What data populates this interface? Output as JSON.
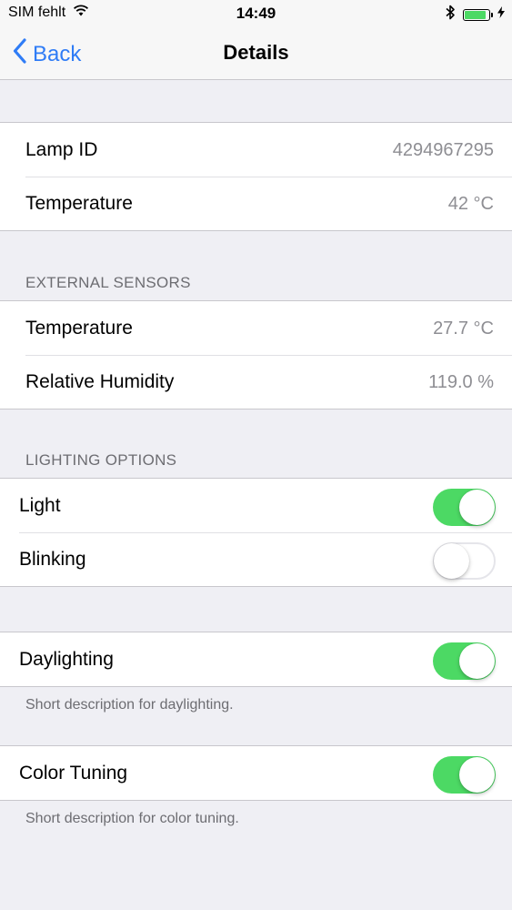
{
  "status_bar": {
    "carrier": "SIM fehlt",
    "time": "14:49",
    "battery_level": 0.9
  },
  "nav": {
    "back_label": "Back",
    "title": "Details"
  },
  "lamp": {
    "rows": [
      {
        "label": "Lamp ID",
        "value": "4294967295"
      },
      {
        "label": "Temperature",
        "value": "42 °C"
      }
    ]
  },
  "external_sensors": {
    "header": "EXTERNAL SENSORS",
    "rows": [
      {
        "label": "Temperature",
        "value": "27.7 °C"
      },
      {
        "label": "Relative Humidity",
        "value": "119.0 %"
      }
    ]
  },
  "lighting_options": {
    "header": "LIGHTING OPTIONS",
    "rows": [
      {
        "label": "Light",
        "on": true
      },
      {
        "label": "Blinking",
        "on": false
      }
    ]
  },
  "daylighting": {
    "label": "Daylighting",
    "on": true,
    "footer": "Short description for daylighting."
  },
  "color_tuning": {
    "label": "Color Tuning",
    "on": true,
    "footer": "Short description for color tuning."
  },
  "colors": {
    "tint": "#2f7cf6",
    "switch_on": "#4cd964",
    "background": "#efeff4"
  }
}
